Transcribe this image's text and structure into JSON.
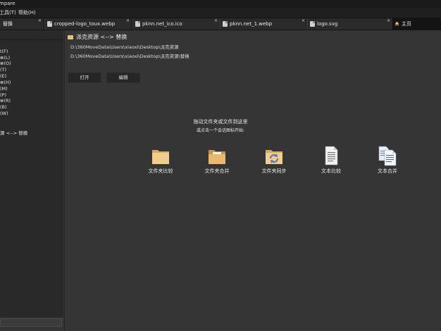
{
  "window": {
    "title": "mpare"
  },
  "menu": [
    {
      "label": "工具(T)"
    },
    {
      "label": "帮助(H)"
    }
  ],
  "tabs": [
    {
      "label": "替换",
      "icon": "document-icon"
    },
    {
      "label": "cropped-logo_toux.webp",
      "icon": "image-file-icon"
    },
    {
      "label": "pknn.net_ico.ico",
      "icon": "image-file-icon"
    },
    {
      "label": "pknn.net_1.webp",
      "icon": "image-file-icon"
    },
    {
      "label": "logo.svg",
      "icon": "image-file-icon"
    }
  ],
  "home_tab": {
    "label": "主页",
    "icon": "home-icon"
  },
  "left_panel": {
    "items": [
      {
        "label": "t(F)"
      },
      {
        "label": "≣(L)"
      },
      {
        "label": "≣(O)"
      },
      {
        "label": "(T)"
      },
      {
        "label": "(E)"
      },
      {
        "label": "≣(H)"
      },
      {
        "label": "(M)"
      },
      {
        "label": "(P)"
      },
      {
        "label": "≣(R)"
      },
      {
        "label": "(B)"
      },
      {
        "label": "(W)"
      }
    ],
    "session_label": "源 <--> 替换"
  },
  "main": {
    "session_title": "派克资源 <--> 替换",
    "left_path": "D:\\360MoveData\\Users\\xiaoxi\\Desktop\\派克资源",
    "right_path": "D:\\360MoveData\\Users\\xiaoxi\\Desktop\\派克资源\\替换",
    "open_button": "打开",
    "edit_button": "编辑",
    "drop_hint_line1": "拖动文件夹或文件到这里",
    "drop_hint_line2": "或点击一个会话图标开始:"
  },
  "actions": [
    {
      "label": "文件夹比较",
      "icon": "folder-icon"
    },
    {
      "label": "文件夹合并",
      "icon": "folder-open-icon"
    },
    {
      "label": "文件夹同步",
      "icon": "folder-sync-icon"
    },
    {
      "label": "文本比较",
      "icon": "text-document-icon"
    },
    {
      "label": "文本合并",
      "icon": "text-documents-icon"
    }
  ],
  "colors": {
    "background": "#353535",
    "panel": "#292929",
    "folder": "#e7c27c",
    "sync_arrow": "#5577cc"
  }
}
